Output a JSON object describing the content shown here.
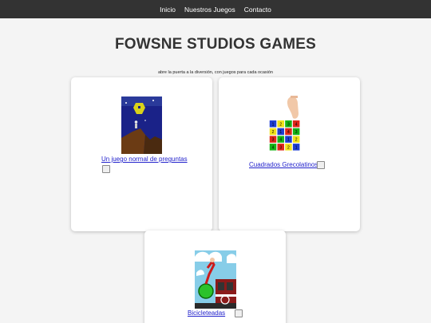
{
  "nav": {
    "items": [
      "Inicio",
      "Nuestros Juegos",
      "Contacto"
    ]
  },
  "header": {
    "title": "FOWSNE STUDIOS GAMES",
    "tagline": "abre la puerta a la diversión, con juegos para cada ocasión"
  },
  "games": [
    {
      "title": "Un juego normal de preguntas"
    },
    {
      "title": "Cuadrados Grecolatinos"
    },
    {
      "title": "Bicicleteadas"
    }
  ],
  "grid_numbers": [
    [
      "1",
      "2",
      "3",
      "4"
    ],
    [
      "2",
      "1",
      "4",
      "3"
    ],
    [
      "3",
      "4",
      "1",
      "2"
    ],
    [
      "4",
      "3",
      "2",
      "1"
    ]
  ],
  "colors": {
    "navbar": "#333333",
    "link": "#2222cc",
    "background": "#f4f4f4"
  }
}
